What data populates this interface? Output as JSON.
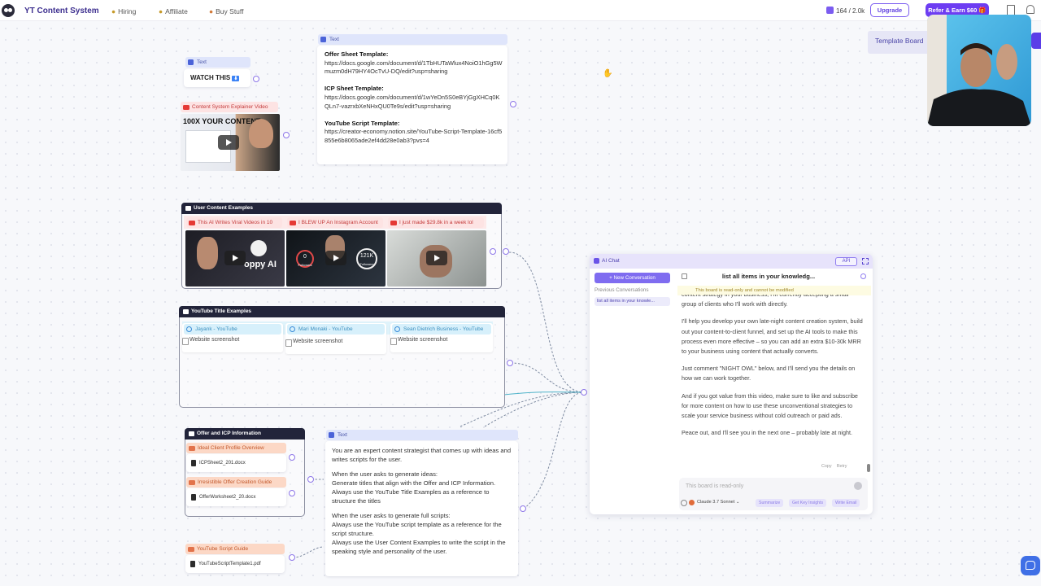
{
  "topbar": {
    "brand": "YT Content System",
    "nav": [
      {
        "label": "Hiring"
      },
      {
        "label": "Affiliate"
      },
      {
        "label": "Buy Stuff"
      }
    ],
    "credits": "164 / 2.0k",
    "upgrade": "Upgrade",
    "refer": "Refer & Earn $60 🎁"
  },
  "canvas": {
    "watch_node": {
      "chip": "Text",
      "text": "WATCH THIS",
      "badge": "⬇"
    },
    "explainer_video": {
      "chip": "Content System Explainer Video",
      "thumb_text": "100X YOUR CONTENT"
    },
    "templates_node": {
      "chip": "Text",
      "sections": [
        {
          "heading": "Offer Sheet Template:",
          "url": "https://docs.google.com/document/d/1TbHUTaWlux4NoiO1hGg5Wmuzm0dH79HY4OcTvU-DQ/edit?usp=sharing"
        },
        {
          "heading": "ICP Sheet Template:",
          "url": "https://docs.google.com/document/d/1wYeDn5S0eBYjGgXHCq0KQLn7-vazrxbXeNHxQU0Te9s/edit?usp=sharing"
        },
        {
          "heading": "YouTube Script Template:",
          "url": "https://creator-economy.notion.site/YouTube-Script-Template-16cf5855e6b8065ade2ef4dd28e0ab3?pvs=4"
        }
      ]
    },
    "user_examples": {
      "title": "User Content Examples",
      "videos": [
        {
          "chip": "This AI Writes Viral Videos in 10 Minu...",
          "thumb_text": "oppy AI"
        },
        {
          "chip": "I BLEW UP An Instagram Account As ...",
          "stat1": "0",
          "stat1_label": "Followers",
          "stat2": "121K",
          "stat2_label": "Followers"
        },
        {
          "chip": "I just made $29.8k in a week lol"
        }
      ]
    },
    "title_examples": {
      "title": "YouTube Title Examples",
      "sites": [
        {
          "chip": "Jayank - YouTube",
          "img": "Website screenshot"
        },
        {
          "chip": "Mari Monaki - YouTube",
          "img": "Website screenshot"
        },
        {
          "chip": "Sean Dietrich Business - YouTube",
          "img": "Website screenshot"
        }
      ]
    },
    "offer_icp": {
      "title": "Offer and ICP Information",
      "items": [
        {
          "chip": "Ideal Client Profile Overview",
          "file": "ICPSheet2_201.docx"
        },
        {
          "chip": "Irresistible Offer Creation Guide",
          "file": "OfferWorksheet2_20.docx"
        }
      ]
    },
    "script_guide": {
      "chip": "YouTube Script Guide",
      "file": "YouTubeScriptTemplate1.pdf"
    },
    "prompt_node": {
      "chip": "Text",
      "lines": [
        "You are an expert content strategist that comes up with ideas and writes scripts for the user.",
        "",
        "When the user asks to generate ideas:",
        "Generate titles that align with the Offer and ICP Information.",
        "Always use the YouTube Title Examples as a reference to structure the titles",
        "",
        "When the user asks to generate full scripts:",
        "Always use the YouTube script template as a reference for the script structure.",
        "Always use the User Content Examples to write the script in the speaking style and personality of the user."
      ]
    },
    "template_board": "Template Board"
  },
  "chat": {
    "header_title": "AI Chat",
    "api_label": "API",
    "new_conversation": "+ New Conversation",
    "previous_label": "Previous Conversations",
    "previous_items": [
      "list all items in your knowle..."
    ],
    "title": "list all items in your knowledg...",
    "readonly_notice": "This board is read-only and cannot be modified",
    "messages": [
      "content strategy in your business, I'm currently accepting a small group of clients who I'll work with directly.",
      "I'll help you develop your own late-night content creation system, build out your content-to-client funnel, and set up the AI tools to make this process even more effective – so you can add an extra $10-30k MRR to your business using content that actually converts.",
      "Just comment \"NIGHT OWL\" below, and I'll send you the details on how we can work together.",
      "And if you got value from this video, make sure to like and subscribe for more content on how to use these unconventional strategies to scale your service business without cold outreach or paid ads.",
      "Peace out, and I'll see you in the next one – probably late at night."
    ],
    "copy_label": "Copy",
    "retry_label": "Retry",
    "input_placeholder": "This board is read-only",
    "model": "Claude 3.7 Sonnet",
    "quick_actions": [
      "Summarize",
      "Get Key Insights",
      "Write Email"
    ]
  }
}
